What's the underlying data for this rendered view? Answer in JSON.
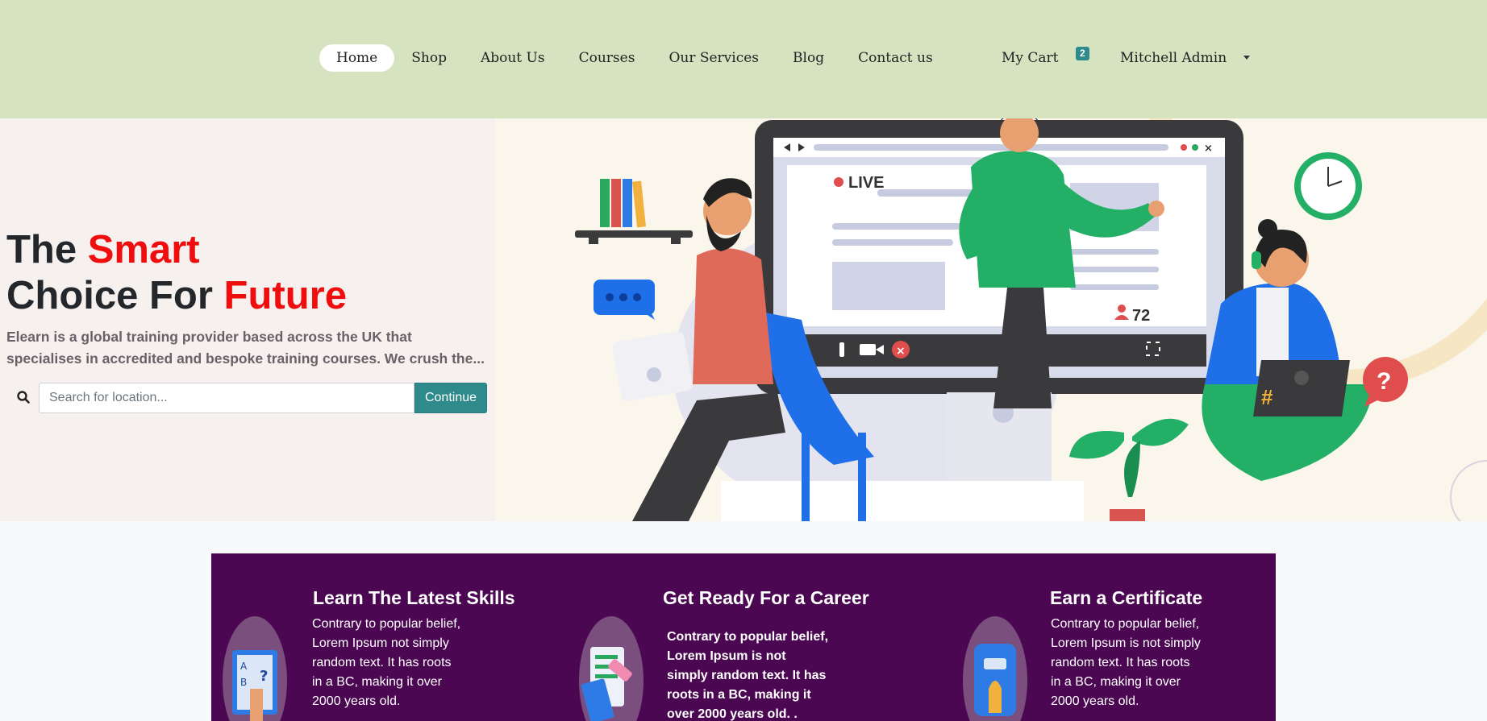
{
  "nav": {
    "items": [
      {
        "label": "Home",
        "active": true
      },
      {
        "label": "Shop"
      },
      {
        "label": "About Us"
      },
      {
        "label": "Courses"
      },
      {
        "label": "Our Services"
      },
      {
        "label": "Blog"
      },
      {
        "label": "Contact us"
      }
    ],
    "cart_label": "My Cart",
    "cart_count": "2",
    "user_name": "Mitchell Admin"
  },
  "hero": {
    "title_the": "The ",
    "title_smart": "Smart",
    "title_choice": "Choice For ",
    "title_future": "Future",
    "description": "Elearn is a global training provider based across the UK that specialises in accredited and bespoke training courses. We crush the...",
    "search_placeholder": "Search for location...",
    "continue_label": "Continue",
    "illustration": {
      "live_label": "LIVE",
      "viewer_count": "72"
    }
  },
  "features": [
    {
      "title": "Learn The Latest Skills",
      "text": "Contrary to popular belief,\nLorem Ipsum  not simply\nrandom text. It has roots\nin a BC, making it over\n2000 years old.",
      "bold": false
    },
    {
      "title": "Get Ready For a Career",
      "text": "Contrary to popular belief,\nLorem Ipsum is not\nsimply random text. It has\nroots in a BC, making it\nover 2000 years old. .",
      "bold": true
    },
    {
      "title": "Earn a Certificate",
      "text": " Contrary to popular belief,\nLorem Ipsum is not simply\nrandom text. It has roots\nin a BC, making it over\n2000 years old.",
      "bold": false
    }
  ],
  "colors": {
    "nav_bg": "#d6e3c1",
    "accent": "#2f8a8c",
    "highlight_red": "#ef0d0d",
    "features_bg": "#4b0752"
  }
}
